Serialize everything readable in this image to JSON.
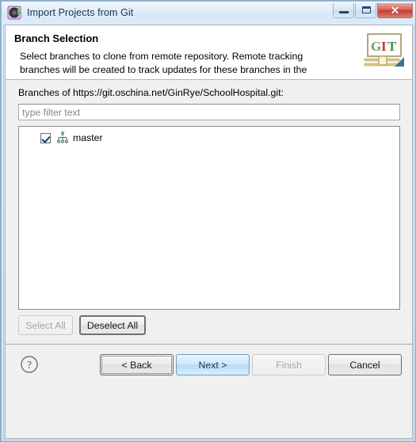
{
  "window": {
    "title": "Import Projects from Git",
    "icon": "eclipse-wizard-icon",
    "minimize_label": "Minimize",
    "maximize_label": "Maximize",
    "close_label": "Close",
    "close_glyph": "✕"
  },
  "header": {
    "title": "Branch Selection",
    "description": "Select branches to clone from remote repository. Remote tracking branches will be created to track updates for these branches in the",
    "logo_text": "GIT",
    "logo_letters": [
      "G",
      "I",
      "T"
    ],
    "logo_colors": {
      "g": "#7a9a6a",
      "i": "#c33a2e",
      "t": "#4f8f4a",
      "frame": "#b0a878",
      "band": "#d9c97a"
    }
  },
  "body": {
    "branches_label": "Branches of https://git.oschina.net/GinRye/SchoolHospital.git:",
    "filter": {
      "value": "",
      "placeholder": "type filter text"
    },
    "branches": [
      {
        "label": "master",
        "checked": true,
        "icon": "git-branch-icon"
      }
    ],
    "selection_buttons": [
      {
        "label": "Select All",
        "name": "select-all-button",
        "enabled": false
      },
      {
        "label": "Deselect All",
        "name": "deselect-all-button",
        "enabled": true
      }
    ]
  },
  "footer": {
    "help_icon": "help-question-icon",
    "buttons": [
      {
        "label": "< Back",
        "name": "back-button",
        "enabled": true,
        "state": "focused"
      },
      {
        "label": "Next >",
        "name": "next-button",
        "enabled": true,
        "state": "default"
      },
      {
        "label": "Finish",
        "name": "finish-button",
        "enabled": false,
        "state": "disabled"
      },
      {
        "label": "Cancel",
        "name": "cancel-button",
        "enabled": true,
        "state": "normal"
      }
    ]
  },
  "colors": {
    "titlebar_start": "#eef5fc",
    "titlebar_end": "#dcebf9",
    "close_button": "#c6392f",
    "default_button_accent": "#b6dcf4",
    "dialog_background": "#f0f0ef",
    "checkbox_check": "#1b3e8a"
  }
}
